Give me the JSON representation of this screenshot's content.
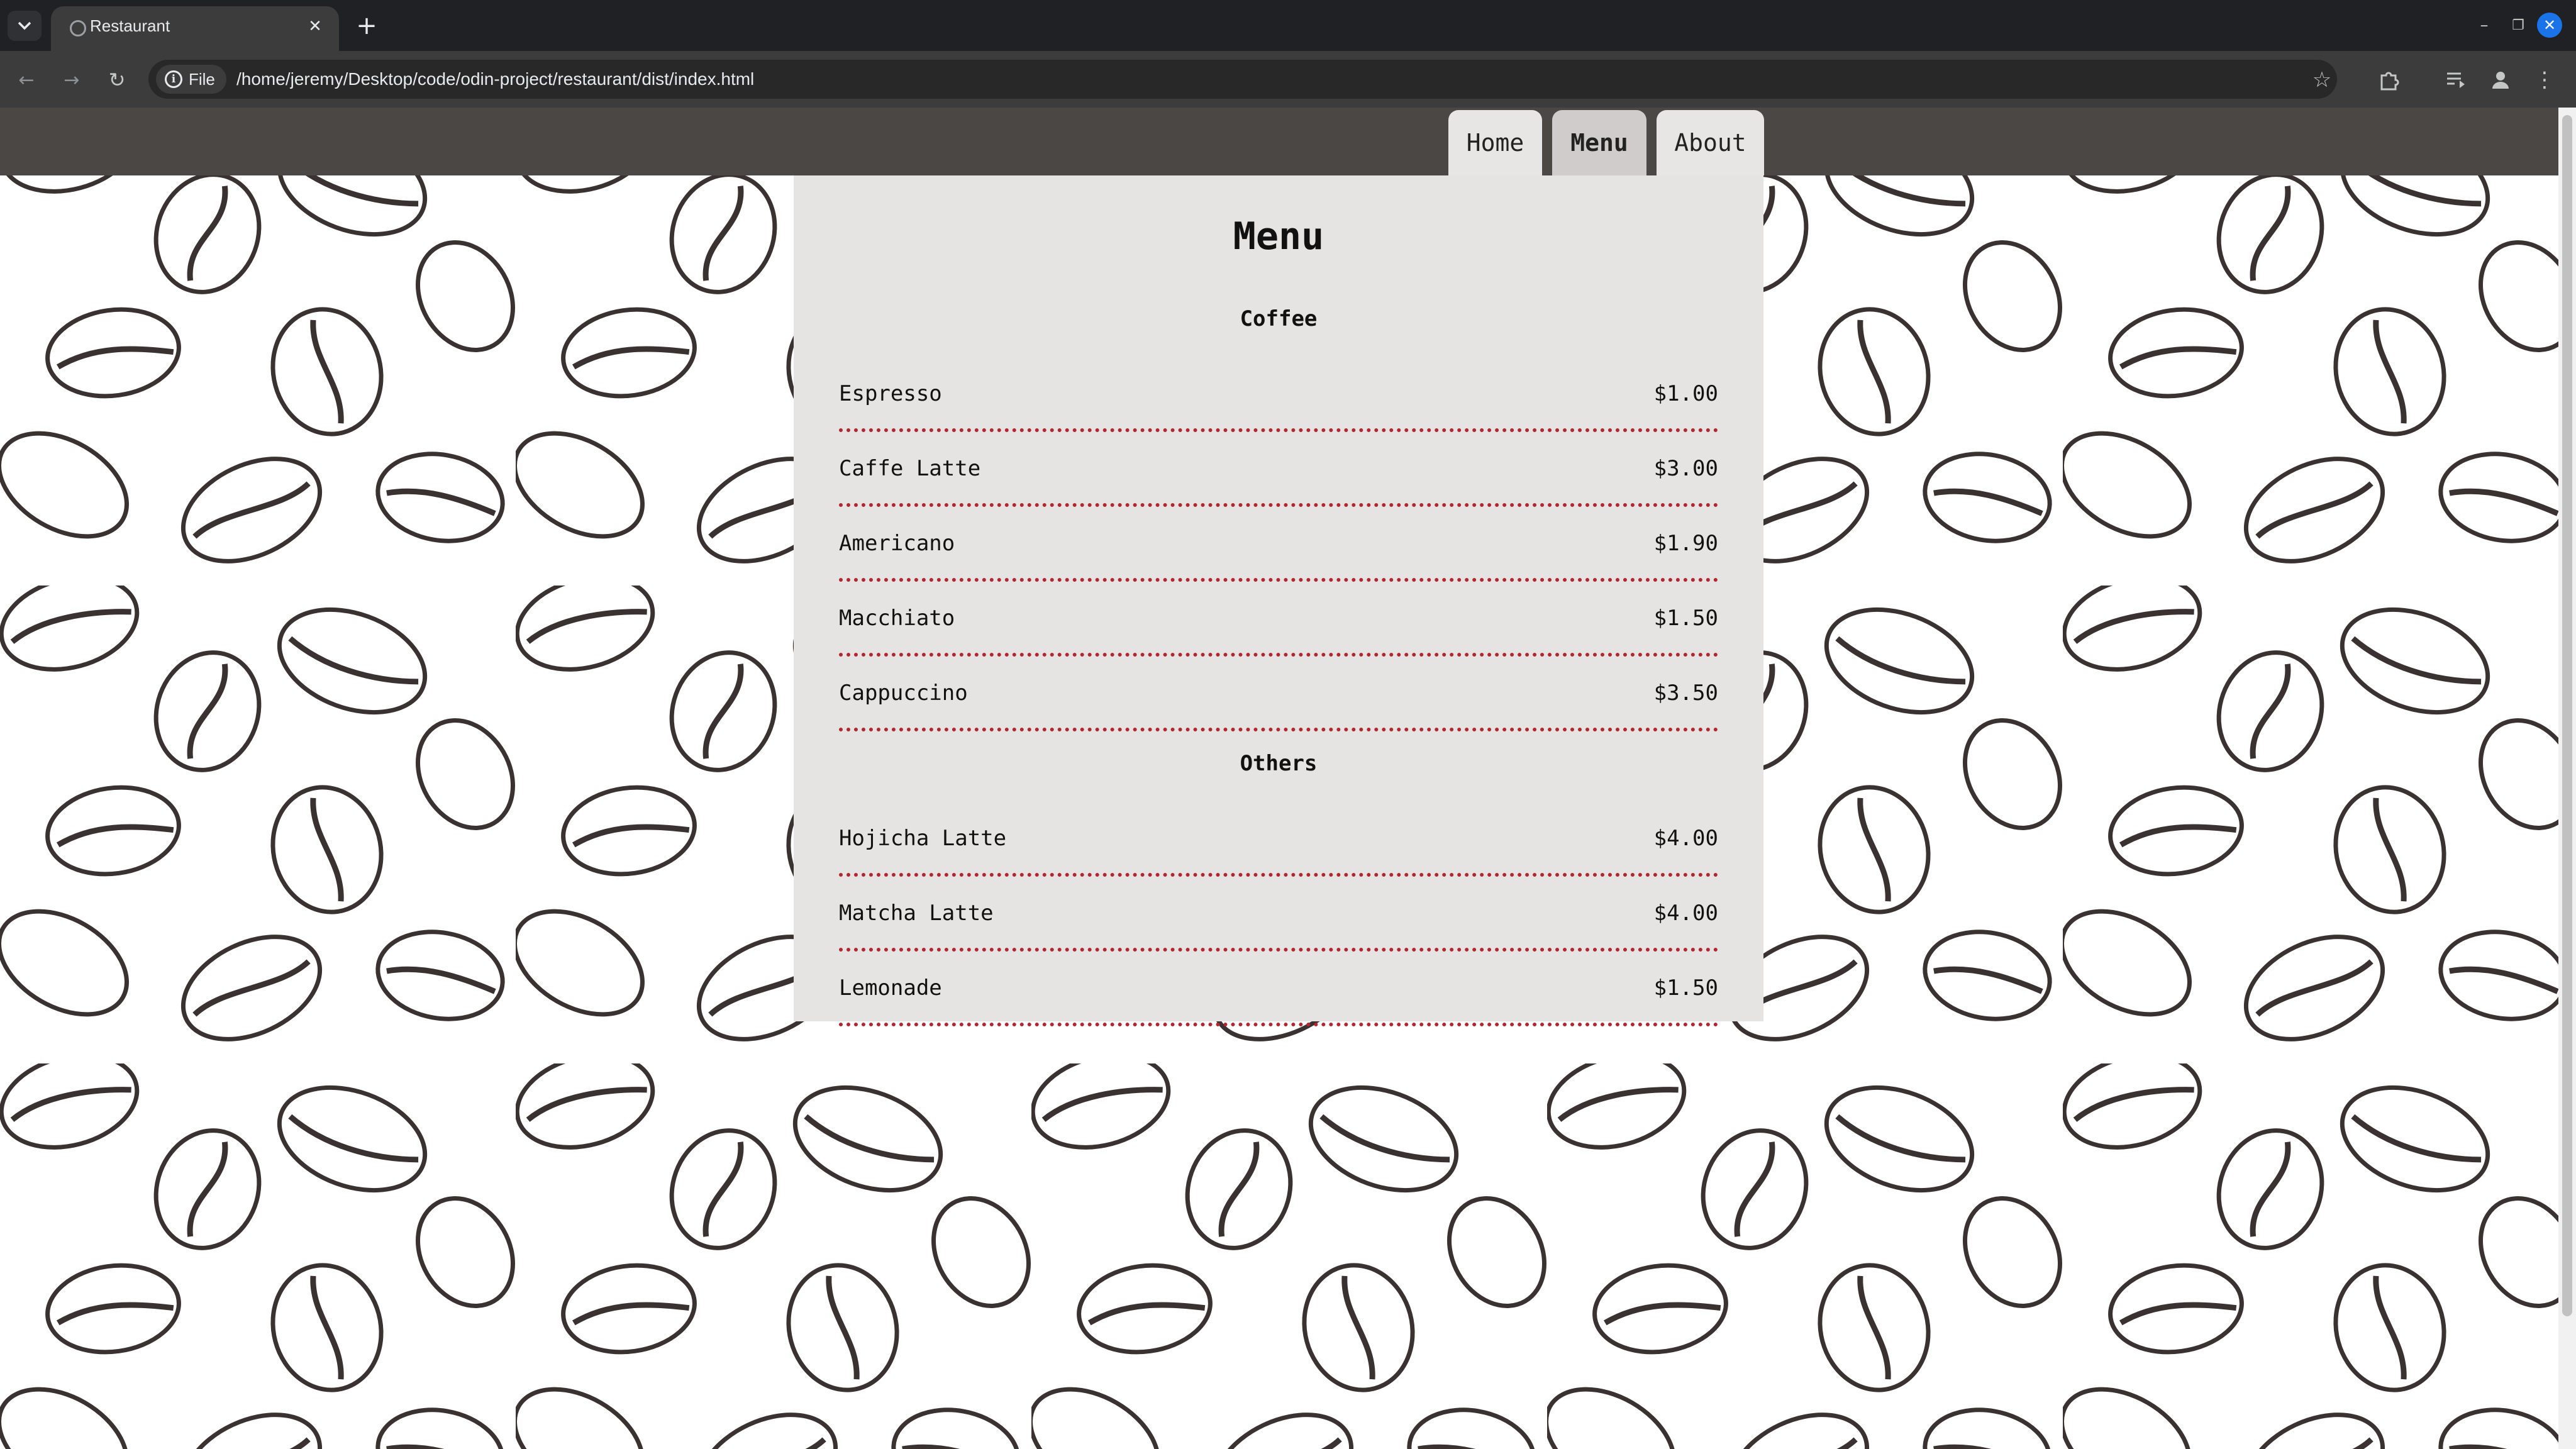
{
  "browser": {
    "tab_title": "Restaurant",
    "site_chip_label": "File",
    "url": "/home/jeremy/Desktop/code/odin-project/restaurant/dist/index.html"
  },
  "nav": {
    "home_label": "Home",
    "menu_label": "Menu",
    "about_label": "About",
    "active_tab": "Menu"
  },
  "menu": {
    "title": "Menu",
    "sections": [
      {
        "heading": "Coffee",
        "items": [
          {
            "name": "Espresso",
            "price": "$1.00"
          },
          {
            "name": "Caffe Latte",
            "price": "$3.00"
          },
          {
            "name": "Americano",
            "price": "$1.90"
          },
          {
            "name": "Macchiato",
            "price": "$1.50"
          },
          {
            "name": "Cappuccino",
            "price": "$3.50"
          }
        ]
      },
      {
        "heading": "Others",
        "items": [
          {
            "name": "Hojicha Latte",
            "price": "$4.00"
          },
          {
            "name": "Matcha Latte",
            "price": "$4.00"
          },
          {
            "name": "Lemonade",
            "price": "$1.50"
          }
        ]
      }
    ]
  },
  "colors": {
    "header_bg": "#4a4744",
    "panel_bg": "#e6e4e2",
    "dotted_rule": "#b3262f",
    "bean": "#3a3230"
  },
  "icons": {
    "tab_search": "chevron-down-icon",
    "new_tab": "plus-icon",
    "back": "arrow-left-icon",
    "forward": "arrow-right-icon",
    "reload": "reload-icon",
    "site_info": "info-icon",
    "bookmark": "star-icon",
    "extensions": "puzzle-icon",
    "media": "media-queue-icon",
    "profile": "person-icon",
    "more": "kebab-menu-icon"
  }
}
